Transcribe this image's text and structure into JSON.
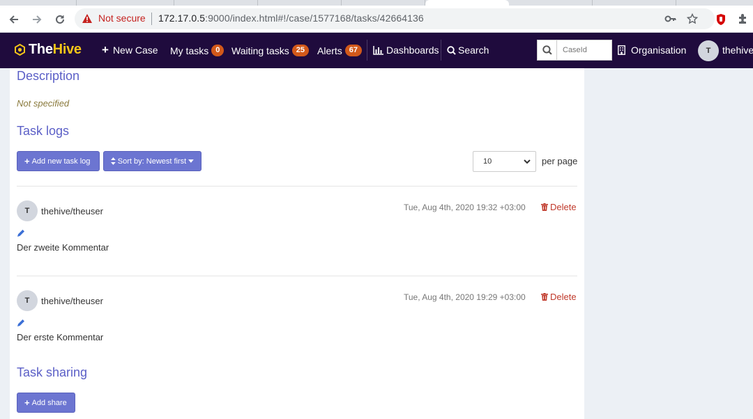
{
  "browser": {
    "security_label": "Not secure",
    "url_host": "172.17.0.5",
    "url_rest": ":9000/index.html#!/case/1577168/tasks/42664136"
  },
  "header": {
    "brand_prefix": "The",
    "brand_suffix": "Hive",
    "new_case": "New Case",
    "my_tasks": "My tasks",
    "my_tasks_count": "0",
    "waiting_tasks": "Waiting tasks",
    "waiting_tasks_count": "25",
    "alerts": "Alerts",
    "alerts_count": "67",
    "dashboards": "Dashboards",
    "search": "Search",
    "caseid_placeholder": "CaseId",
    "organisation": "Organisation",
    "user_initial": "T",
    "username": "thehive"
  },
  "description": {
    "title": "Description",
    "value": "Not specified"
  },
  "tasklogs": {
    "title": "Task logs",
    "add_button": "Add new task log",
    "sort_button": "Sort by: Newest first",
    "per_page_value": "10",
    "per_page_label": "per page",
    "delete_label": "Delete",
    "entries": [
      {
        "initial": "T",
        "user": "thehive/theuser",
        "date": "Tue, Aug 4th, 2020 19:32 +03:00",
        "text": "Der zweite Kommentar"
      },
      {
        "initial": "T",
        "user": "thehive/theuser",
        "date": "Tue, Aug 4th, 2020 19:29 +03:00",
        "text": "Der erste Kommentar"
      }
    ]
  },
  "sharing": {
    "title": "Task sharing",
    "add_button": "Add share"
  },
  "colors": {
    "header_bg": "#1f0b3d",
    "accent": "#6c75d1",
    "heading": "#5b5fc7",
    "badge": "#d2591a",
    "danger": "#c0392b"
  }
}
